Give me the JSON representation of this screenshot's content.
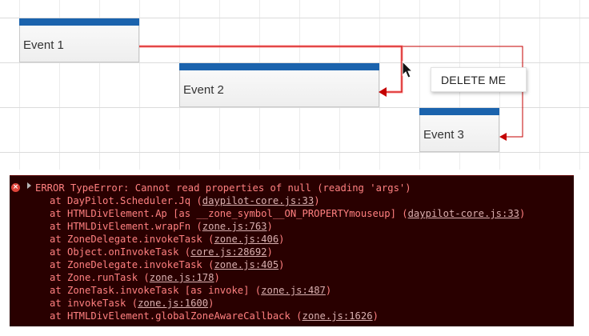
{
  "scheduler": {
    "events": [
      {
        "id": "event-1",
        "text": "Event 1"
      },
      {
        "id": "event-2",
        "text": "Event 2"
      },
      {
        "id": "event-3",
        "text": "Event 3"
      }
    ],
    "context_menu": {
      "item": "DELETE ME"
    }
  },
  "colors": {
    "event_bar": "#1b63ad",
    "link_line": "#c40000",
    "link_highlight": "#ff5555",
    "console_bg": "#290000",
    "console_text": "#ff8080"
  },
  "icons": {
    "error": "error-circle-icon",
    "expander": "expand-triangle-icon",
    "cursor": "mouse-pointer-icon"
  },
  "console": {
    "error_message": "ERROR TypeError: Cannot read properties of null (reading 'args')",
    "stack": [
      {
        "prefix": "at DayPilot.Scheduler.Jq (",
        "link": "daypilot-core.js:33",
        "suffix": ")"
      },
      {
        "prefix": "at HTMLDivElement.Ap [as __zone_symbol__ON_PROPERTYmouseup] (",
        "link": "daypilot-core.js:33",
        "suffix": ")"
      },
      {
        "prefix": "at HTMLDivElement.wrapFn (",
        "link": "zone.js:763",
        "suffix": ")"
      },
      {
        "prefix": "at ZoneDelegate.invokeTask (",
        "link": "zone.js:406",
        "suffix": ")"
      },
      {
        "prefix": "at Object.onInvokeTask (",
        "link": "core.js:28692",
        "suffix": ")"
      },
      {
        "prefix": "at ZoneDelegate.invokeTask (",
        "link": "zone.js:405",
        "suffix": ")"
      },
      {
        "prefix": "at Zone.runTask (",
        "link": "zone.js:178",
        "suffix": ")"
      },
      {
        "prefix": "at ZoneTask.invokeTask [as invoke] (",
        "link": "zone.js:487",
        "suffix": ")"
      },
      {
        "prefix": "at invokeTask (",
        "link": "zone.js:1600",
        "suffix": ")"
      },
      {
        "prefix": "at HTMLDivElement.globalZoneAwareCallback (",
        "link": "zone.js:1626",
        "suffix": ")"
      }
    ]
  }
}
